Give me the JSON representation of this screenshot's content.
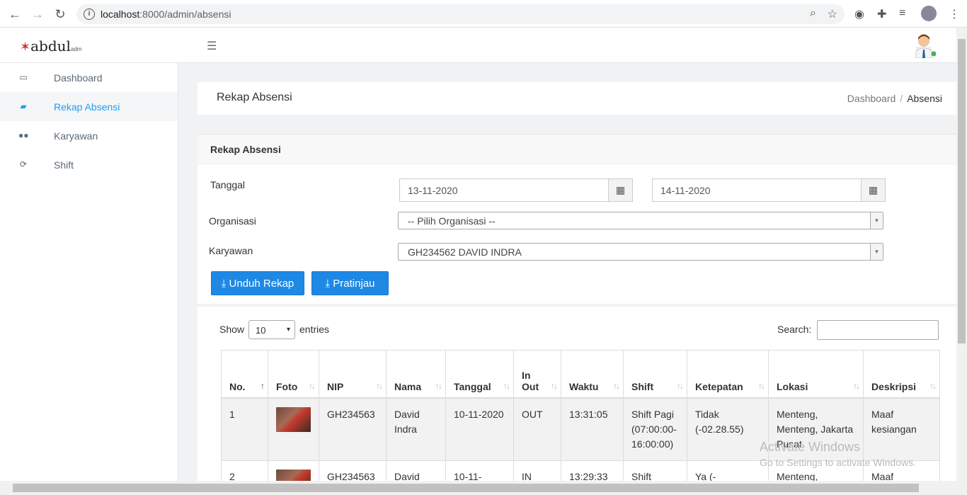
{
  "browser": {
    "url_host": "localhost",
    "url_path": ":8000/admin/absensi"
  },
  "app": {
    "logo": "abdul",
    "logo_suffix": "adm"
  },
  "sidebar": {
    "items": [
      {
        "label": "Dashboard",
        "icon": "laptop-icon",
        "glyph": "💻"
      },
      {
        "label": "Rekap Absensi",
        "icon": "book-icon",
        "glyph": "▰"
      },
      {
        "label": "Karyawan",
        "icon": "users-icon",
        "glyph": "👥"
      },
      {
        "label": "Shift",
        "icon": "refresh-icon",
        "glyph": "↻"
      }
    ]
  },
  "page": {
    "title": "Rekap Absensi",
    "breadcrumb": [
      "Dashboard",
      "Absensi"
    ]
  },
  "form": {
    "card_title": "Rekap Absensi",
    "tanggal_label": "Tanggal",
    "date_from": "13-11-2020",
    "date_to": "14-11-2020",
    "organisasi_label": "Organisasi",
    "organisasi_value": "-- Pilih Organisasi --",
    "karyawan_label": "Karyawan",
    "karyawan_value": "GH234562 DAVID INDRA",
    "unduh_label": "Unduh Rekap",
    "pratinjau_label": "Pratinjau"
  },
  "table_controls": {
    "show": "Show",
    "entries_value": "10",
    "entries": "entries",
    "search": "Search:"
  },
  "table": {
    "headers": [
      "No.",
      "Foto",
      "NIP",
      "Nama",
      "Tanggal",
      "In Out",
      "Waktu",
      "Shift",
      "Ketepatan",
      "Lokasi",
      "Deskripsi"
    ],
    "rows": [
      [
        "1",
        "",
        "GH234563",
        "David Indra",
        "10-11-2020",
        "OUT",
        "13:31:05",
        "Shift Pagi (07:00:00-16:00:00)",
        "Tidak (-02.28.55)",
        "Menteng, Menteng, Jakarta Pusat",
        "Maaf kesiangan"
      ],
      [
        "2",
        "",
        "GH234563",
        "David",
        "10-11-",
        "IN",
        "13:29:33",
        "Shift",
        "Ya (-",
        "Menteng,",
        "Maaf"
      ]
    ]
  },
  "watermark": {
    "line1": "Activate Windows",
    "line2": "Go to Settings to activate Windows."
  }
}
